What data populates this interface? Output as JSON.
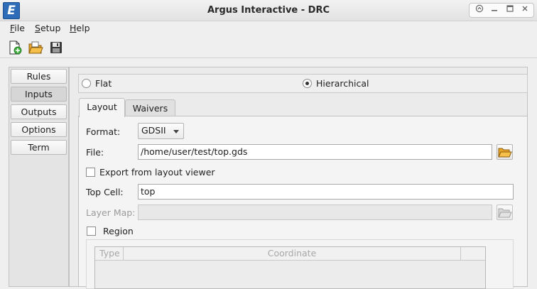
{
  "window": {
    "title": "Argus Interactive - DRC",
    "app_icon_letter": "E"
  },
  "menu": [
    {
      "mnemonic": "F",
      "rest": "ile"
    },
    {
      "mnemonic": "S",
      "rest": "etup"
    },
    {
      "mnemonic": "H",
      "rest": "elp"
    }
  ],
  "toolbar": {
    "icons": [
      "new-file-icon",
      "open-folder-icon",
      "save-disk-icon"
    ]
  },
  "nav": {
    "items": [
      {
        "label": "Rules",
        "active": false
      },
      {
        "label": "Inputs",
        "active": true
      },
      {
        "label": "Outputs",
        "active": false
      },
      {
        "label": "Options",
        "active": false
      },
      {
        "label": "Term",
        "active": false
      }
    ]
  },
  "mode": {
    "flat_label": "Flat",
    "hierarchical_label": "Hierarchical",
    "selected": "Hierarchical"
  },
  "tabs": [
    {
      "label": "Layout",
      "active": true
    },
    {
      "label": "Waivers",
      "active": false
    }
  ],
  "layout": {
    "format_label": "Format:",
    "format_value": "GDSII",
    "file_label": "File:",
    "file_value": "/home/user/test/top.gds",
    "export_label": "Export from layout viewer",
    "export_checked": false,
    "top_cell_label": "Top Cell:",
    "top_cell_value": "top",
    "layer_map_label": "Layer Map:",
    "layer_map_value": "",
    "region_label": "Region",
    "region_checked": false,
    "region_columns": [
      "Type",
      "Coordinate"
    ]
  }
}
